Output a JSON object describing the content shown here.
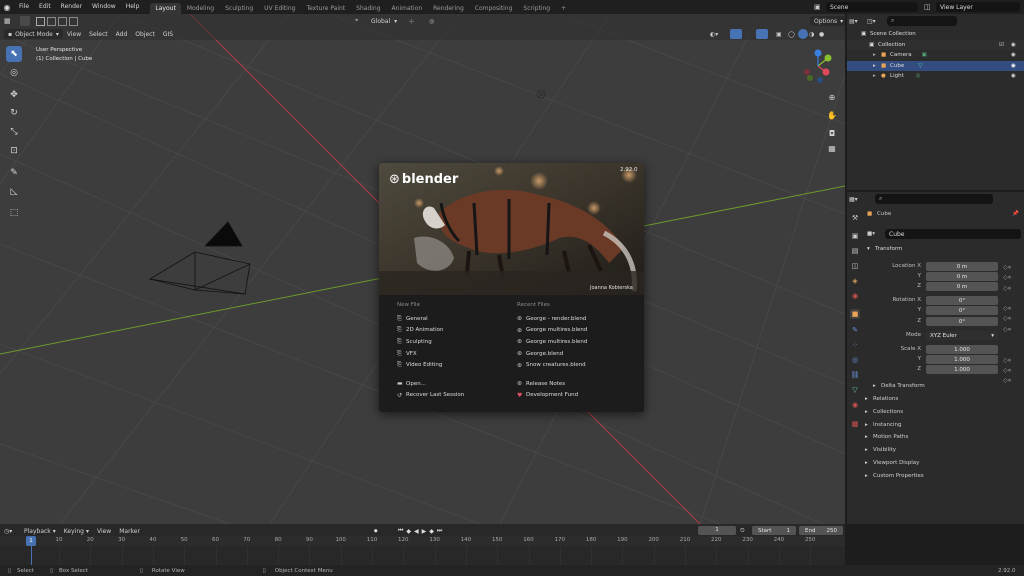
{
  "topbar": {
    "menus": [
      "File",
      "Edit",
      "Render",
      "Window",
      "Help"
    ],
    "workspaces": [
      "Layout",
      "Modeling",
      "Sculpting",
      "UV Editing",
      "Texture Paint",
      "Shading",
      "Animation",
      "Rendering",
      "Compositing",
      "Scripting"
    ],
    "active_workspace": "Layout",
    "add_tab": "+",
    "scene": "Scene",
    "view_layer": "View Layer"
  },
  "viewport": {
    "mode": "Object Mode",
    "menus": [
      "View",
      "Select",
      "Add",
      "Object",
      "GIS"
    ],
    "orientation": "Global",
    "options": "Options",
    "info_line1": "User Perspective",
    "info_line2": "(1) Collection | Cube",
    "gizmo_x": "X",
    "gizmo_y": "Y",
    "gizmo_z": "Z"
  },
  "splash": {
    "brand": "blender",
    "version": "2.92.0",
    "credit": "Joanna Kobierska",
    "new_file_heading": "New File",
    "new_file_items": [
      "General",
      "2D Animation",
      "Sculpting",
      "VFX",
      "Video Editing"
    ],
    "recent_heading": "Recent Files",
    "recent_items": [
      "George - render.blend",
      "George multires.blend",
      "George multires.blend",
      "George.blend",
      "Snow creatures.blend"
    ],
    "open": "Open...",
    "recover": "Recover Last Session",
    "release_notes": "Release Notes",
    "dev_fund": "Development Fund"
  },
  "outliner": {
    "scene_collection": "Scene Collection",
    "collection": "Collection",
    "items": [
      "Camera",
      "Cube",
      "Light"
    ]
  },
  "properties": {
    "object_name": "Cube",
    "data_name": "Cube",
    "transform": "Transform",
    "location_x_label": "Location X",
    "rotation_x_label": "Rotation X",
    "scale_x_label": "Scale X",
    "y_label": "Y",
    "z_label": "Z",
    "location": [
      "0 m",
      "0 m",
      "0 m"
    ],
    "rotation": [
      "0°",
      "0°",
      "0°"
    ],
    "mode_label": "Mode",
    "mode_value": "XYZ Euler",
    "scale": [
      "1.000",
      "1.000",
      "1.000"
    ],
    "delta_transform": "Delta Transform",
    "panels": [
      "Relations",
      "Collections",
      "Instancing",
      "Motion Paths",
      "Visibility",
      "Viewport Display",
      "Custom Properties"
    ]
  },
  "timeline": {
    "menus": [
      "Playback",
      "Keying",
      "View",
      "Marker"
    ],
    "current_frame": "1",
    "start_label": "Start",
    "start": "1",
    "end_label": "End",
    "end": "250",
    "ticks": [
      "1",
      "10",
      "20",
      "30",
      "40",
      "50",
      "60",
      "70",
      "80",
      "90",
      "100",
      "110",
      "120",
      "130",
      "140",
      "150",
      "160",
      "170",
      "180",
      "190",
      "200",
      "210",
      "220",
      "230",
      "240",
      "250"
    ]
  },
  "statusbar": {
    "select": "Select",
    "box_select": "Box Select",
    "rotate_view": "Rotate View",
    "context_menu": "Object Context Menu",
    "version": "2.92.0"
  },
  "colors": {
    "accent": "#4772b3",
    "x_axis": "#b23a48",
    "y_axis": "#6b9a2c",
    "viewport_bg": "#3d3d3d"
  }
}
